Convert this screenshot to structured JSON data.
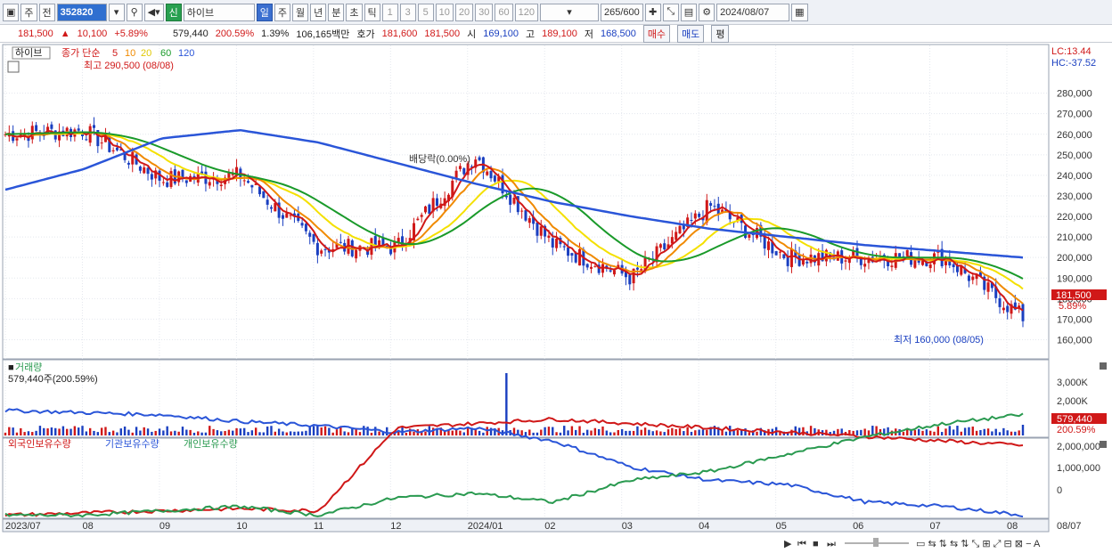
{
  "toolbar": {
    "type_select": "주",
    "prev_label": "전",
    "stock_code": "352820",
    "stock_badge": "신",
    "stock_name": "하이브",
    "periods": [
      "일",
      "주",
      "월",
      "년",
      "분",
      "초",
      "틱"
    ],
    "active_period": "일",
    "intervals": [
      "1",
      "3",
      "5",
      "10",
      "20",
      "30",
      "60",
      "120"
    ],
    "page_count": "265/600",
    "date": "2024/08/07"
  },
  "quote": {
    "price": "181,500",
    "change": "10,100",
    "change_pct": "+5.89%",
    "volume": "579,440",
    "volume_pct": "200.59%",
    "turnover_pct": "1.39%",
    "amount": "106,165백만",
    "bid_label": "호가",
    "bid1": "181,600",
    "bid2": "181,500",
    "open_label": "시",
    "open": "169,100",
    "high_label": "고",
    "high": "189,100",
    "low_label": "저",
    "low": "168,500",
    "buy_label": "매수",
    "sell_label": "매도",
    "avg_label": "평"
  },
  "price_panel": {
    "title": "하이브",
    "indicator_label": "종가 단순",
    "ma_periods": [
      "5",
      "10",
      "20",
      "60",
      "120"
    ],
    "high_note": "최고 290,500 (08/08)",
    "low_note": "최저 160,000 (08/05)",
    "dividend_note": "배당락(0.00%)",
    "lc": "LC:13.44",
    "hc": "HC:-37.52",
    "y_ticks": [
      "280,000",
      "270,000",
      "260,000",
      "250,000",
      "240,000",
      "230,000",
      "220,000",
      "210,000",
      "200,000",
      "190,000",
      "180,000",
      "170,000",
      "160,000"
    ],
    "last_price_tag": "181,500",
    "last_pct_tag": "5.89%"
  },
  "volume_panel": {
    "title": "거래량",
    "current": "579,440주(200.59%)",
    "y_ticks": [
      "3,000K",
      "2,000K",
      "1,000K"
    ],
    "last_tag": "579,440",
    "last_pct_tag": "200.59%"
  },
  "holding_panel": {
    "legend": [
      "외국인보유수량",
      "기관보유수량",
      "개인보유수량"
    ],
    "y_ticks": [
      "2,000,000",
      "1,000,000",
      "0"
    ]
  },
  "x_axis": {
    "labels": [
      "2023/07",
      "08",
      "09",
      "10",
      "11",
      "12",
      "2024/01",
      "02",
      "03",
      "04",
      "05",
      "06",
      "07",
      "08"
    ],
    "right_label": "08/07"
  },
  "colors": {
    "up": "#d01818",
    "down": "#1a3fc0",
    "ma5": "#d01818",
    "ma10": "#f08a00",
    "ma20": "#f4e000",
    "ma60": "#1a9a2a",
    "ma120": "#2a55d8",
    "foreign": "#2a55d8",
    "institution": "#d01818",
    "individual": "#2a9a50"
  },
  "chart_data": {
    "type": "line",
    "y_range": [
      155000,
      295000
    ],
    "x": [
      "2023/07",
      "08",
      "09",
      "10",
      "11",
      "12",
      "2024/01",
      "02",
      "03",
      "04",
      "05",
      "06",
      "07",
      "08"
    ],
    "series": [
      {
        "name": "종가",
        "values": [
          260000,
          262000,
          238000,
          240000,
          205000,
          205000,
          250000,
          206000,
          190000,
          225000,
          200000,
          200000,
          200000,
          171000
        ]
      },
      {
        "name": "120",
        "values": [
          233000,
          243000,
          258000,
          262000,
          256000,
          246000,
          236000,
          227000,
          220000,
          214000,
          210000,
          206000,
          203000,
          200000
        ]
      }
    ]
  }
}
